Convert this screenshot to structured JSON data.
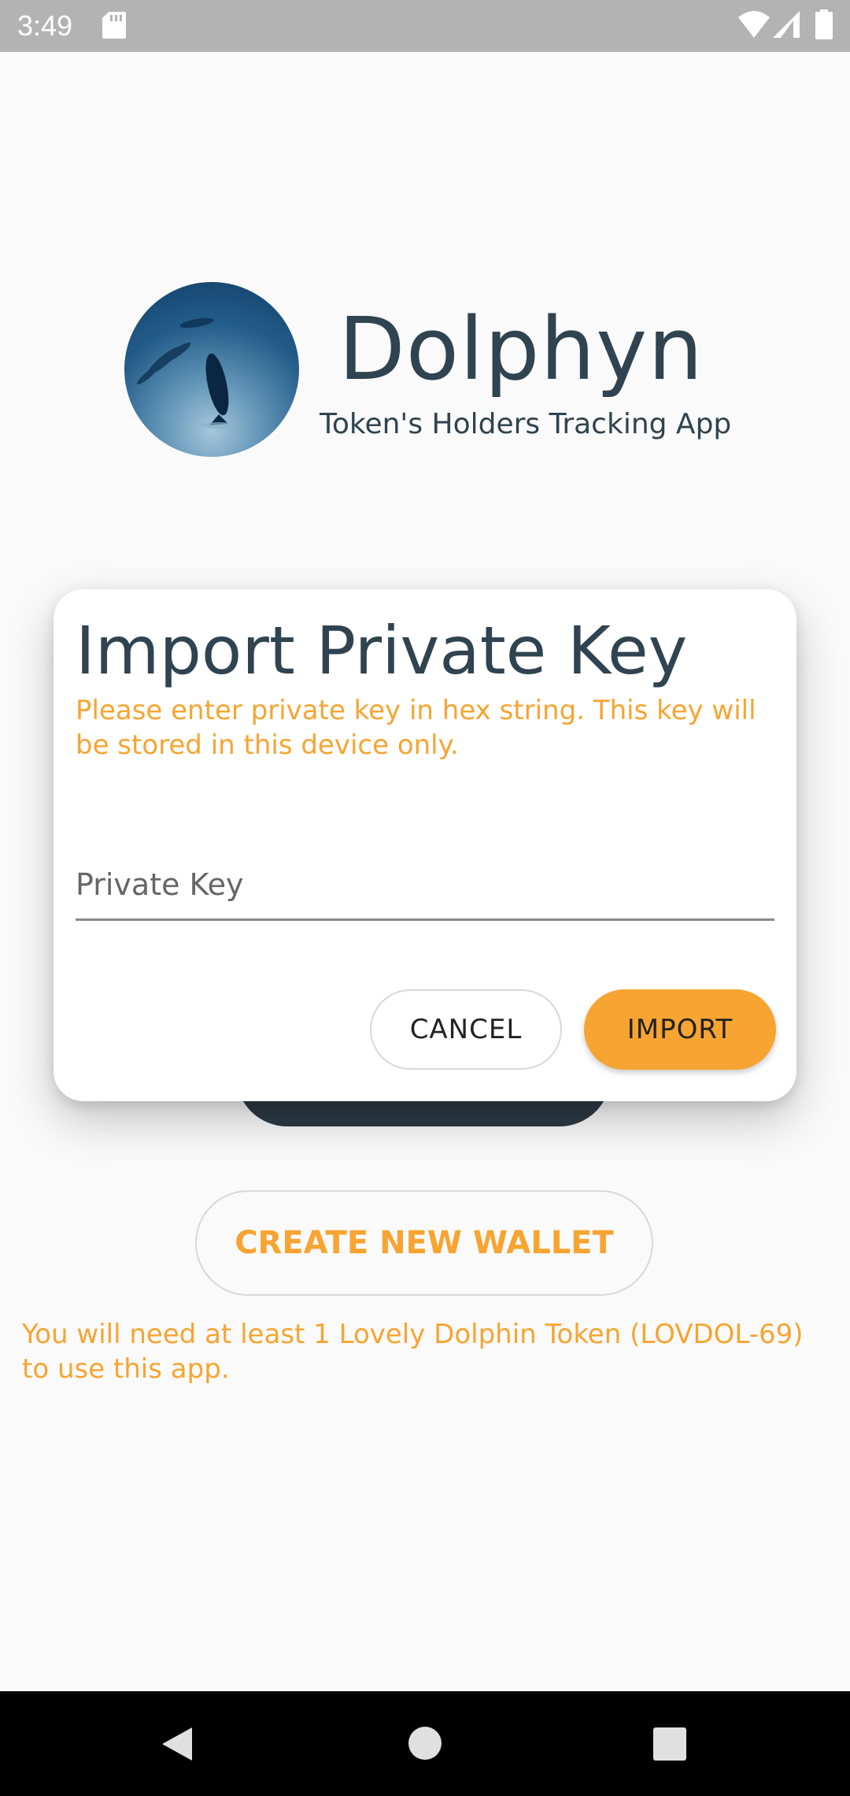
{
  "status_bar": {
    "time": "3:49",
    "icons": [
      "sd-card-icon",
      "wifi-icon",
      "signal-icon",
      "battery-icon"
    ]
  },
  "app": {
    "title": "Dolphyn",
    "subtitle": "Token's Holders Tracking App",
    "logo": "dolphin-logo"
  },
  "dialog": {
    "title": "Import Private Key",
    "message": "Please enter private key in hex string. This key will be stored in this device only.",
    "input_placeholder": "Private Key",
    "input_value": "",
    "cancel_label": "CANCEL",
    "import_label": "IMPORT"
  },
  "main": {
    "create_wallet_label": "CREATE NEW WALLET",
    "notice": "You will need at least 1 Lovely Dolphin Token (LOVDOL-69) to use this app."
  },
  "nav_bar": {
    "icons": [
      "back-icon",
      "home-icon",
      "recents-icon"
    ]
  },
  "colors": {
    "accent": "#f7a432",
    "text_dark": "#2f4350",
    "status_bar": "#b3b3b3",
    "nav_bar": "#000000"
  }
}
